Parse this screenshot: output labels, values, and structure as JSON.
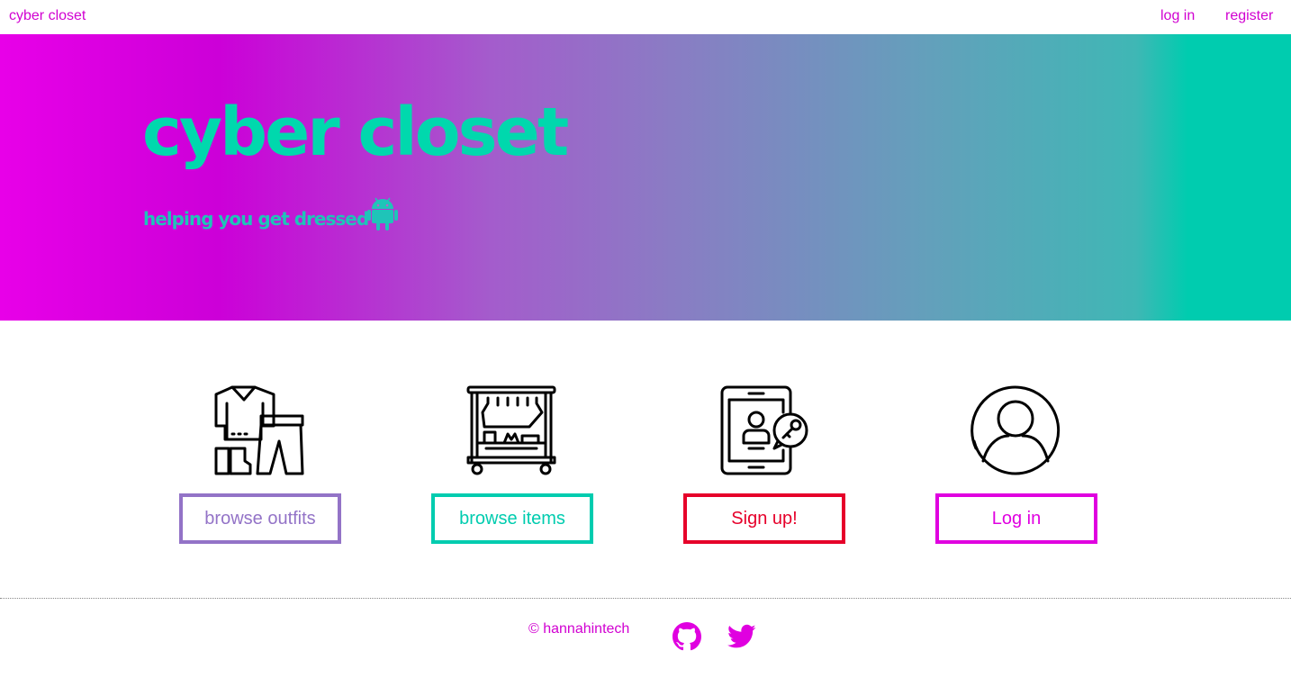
{
  "nav": {
    "brand": "cyber closet",
    "login": "log in",
    "register": "register"
  },
  "hero": {
    "title": "cyber closet",
    "subtitle": "helping you get dressed",
    "subtitle_icon": "android-icon"
  },
  "features": [
    {
      "icon": "clothes-outfit-icon",
      "label": "browse outfits",
      "color": "#9373c7"
    },
    {
      "icon": "clothing-rack-icon",
      "label": "browse items",
      "color": "#00ccaf"
    },
    {
      "icon": "tablet-key-icon",
      "label": "Sign up!",
      "color": "#e6002a"
    },
    {
      "icon": "user-avatar-icon",
      "label": "Log in",
      "color": "#e000e0"
    }
  ],
  "footer": {
    "copyright": "© hannahintech",
    "icons": [
      "github-icon",
      "twitter-icon"
    ]
  },
  "colors": {
    "accent": "#d100d1",
    "teal": "#00d8ad"
  }
}
